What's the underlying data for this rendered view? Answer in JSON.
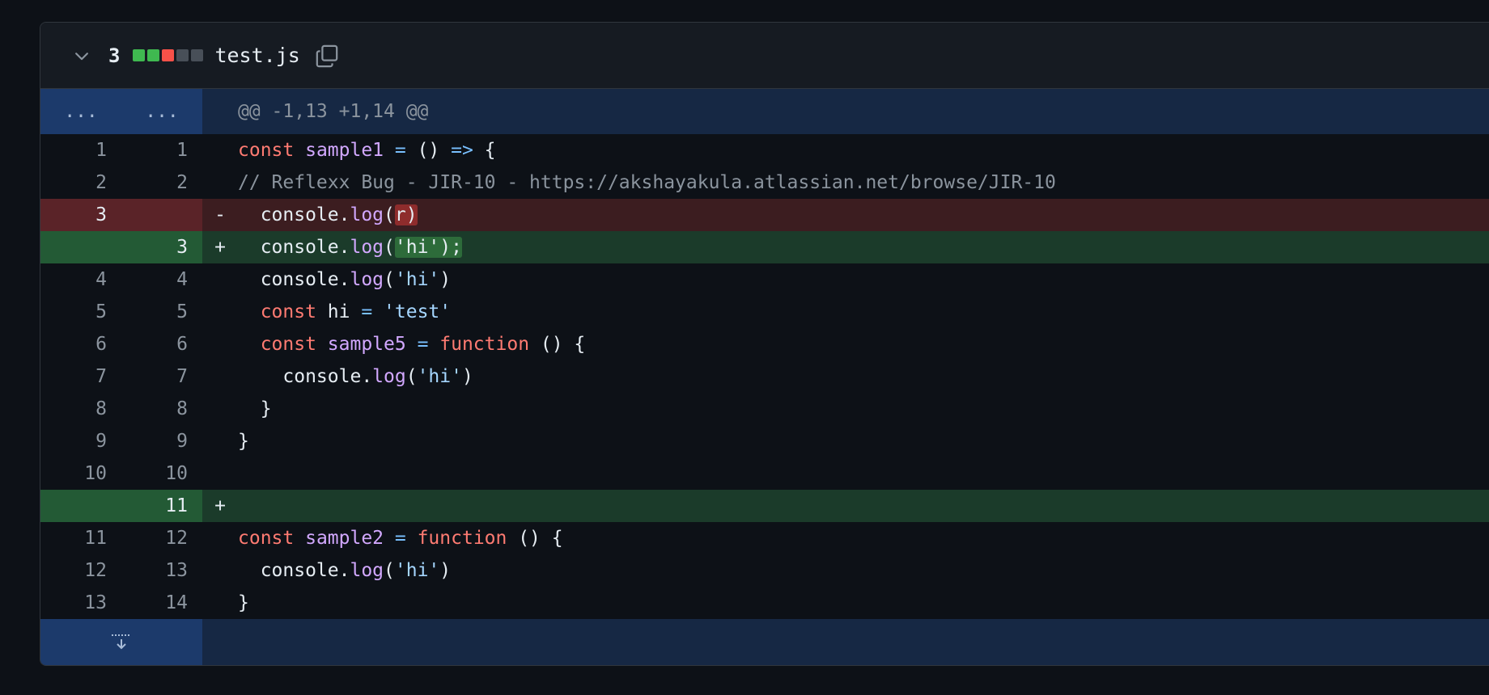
{
  "file": {
    "change_count": "3",
    "name": "test.js",
    "diffstat": [
      "#3fb950",
      "#3fb950",
      "#f85149",
      "#484f58",
      "#484f58"
    ],
    "icons": {
      "collapse": "chevron-down-icon",
      "copy": "copy-icon",
      "expand": "expand-down-icon"
    }
  },
  "hunk": {
    "old_marker": "...",
    "new_marker": "...",
    "header": "@@ -1,13 +1,14 @@"
  },
  "lines": [
    {
      "type": "ctx",
      "old": "1",
      "new": "1",
      "marker": "",
      "tokens": [
        [
          "kw",
          "const "
        ],
        [
          "fn",
          "sample1"
        ],
        [
          "op",
          " = "
        ],
        [
          "pl",
          "() "
        ],
        [
          "op",
          "=>"
        ],
        [
          "pl",
          " {"
        ]
      ]
    },
    {
      "type": "ctx",
      "old": "2",
      "new": "2",
      "marker": "",
      "tokens": [
        [
          "cm",
          "// Reflexx Bug - JIR-10 - https://akshayakula.atlassian.net/browse/JIR-10"
        ]
      ]
    },
    {
      "type": "del",
      "old": "3",
      "new": "",
      "marker": "-",
      "tokens": [
        [
          "pl",
          "  console."
        ],
        [
          "fn",
          "log"
        ],
        [
          "pl",
          "("
        ],
        [
          "hl-del",
          "r)"
        ]
      ]
    },
    {
      "type": "add",
      "old": "",
      "new": "3",
      "marker": "+",
      "tokens": [
        [
          "pl",
          "  console."
        ],
        [
          "fn",
          "log"
        ],
        [
          "pl",
          "("
        ],
        [
          "hl-add",
          "'hi');"
        ]
      ]
    },
    {
      "type": "ctx",
      "old": "4",
      "new": "4",
      "marker": "",
      "tokens": [
        [
          "pl",
          "  console."
        ],
        [
          "fn",
          "log"
        ],
        [
          "pl",
          "("
        ],
        [
          "str",
          "'hi'"
        ],
        [
          "pl",
          ")"
        ]
      ]
    },
    {
      "type": "ctx",
      "old": "5",
      "new": "5",
      "marker": "",
      "tokens": [
        [
          "kw",
          "  const "
        ],
        [
          "pl",
          "hi "
        ],
        [
          "op",
          "= "
        ],
        [
          "str",
          "'test'"
        ]
      ]
    },
    {
      "type": "ctx",
      "old": "6",
      "new": "6",
      "marker": "",
      "tokens": [
        [
          "kw",
          "  const "
        ],
        [
          "fn",
          "sample5"
        ],
        [
          "op",
          " = "
        ],
        [
          "kw",
          "function "
        ],
        [
          "pl",
          "() {"
        ]
      ]
    },
    {
      "type": "ctx",
      "old": "7",
      "new": "7",
      "marker": "",
      "tokens": [
        [
          "pl",
          "    console."
        ],
        [
          "fn",
          "log"
        ],
        [
          "pl",
          "("
        ],
        [
          "str",
          "'hi'"
        ],
        [
          "pl",
          ")"
        ]
      ]
    },
    {
      "type": "ctx",
      "old": "8",
      "new": "8",
      "marker": "",
      "tokens": [
        [
          "pl",
          "  }"
        ]
      ]
    },
    {
      "type": "ctx",
      "old": "9",
      "new": "9",
      "marker": "",
      "tokens": [
        [
          "pl",
          "}"
        ]
      ]
    },
    {
      "type": "ctx",
      "old": "10",
      "new": "10",
      "marker": "",
      "tokens": [
        [
          "pl",
          ""
        ]
      ]
    },
    {
      "type": "add",
      "old": "",
      "new": "11",
      "marker": "+",
      "tokens": [
        [
          "pl",
          ""
        ]
      ]
    },
    {
      "type": "ctx",
      "old": "11",
      "new": "12",
      "marker": "",
      "tokens": [
        [
          "kw",
          "const "
        ],
        [
          "fn",
          "sample2"
        ],
        [
          "op",
          " = "
        ],
        [
          "kw",
          "function "
        ],
        [
          "pl",
          "() {"
        ]
      ]
    },
    {
      "type": "ctx",
      "old": "12",
      "new": "13",
      "marker": "",
      "tokens": [
        [
          "pl",
          "  console."
        ],
        [
          "fn",
          "log"
        ],
        [
          "pl",
          "("
        ],
        [
          "str",
          "'hi'"
        ],
        [
          "pl",
          ")"
        ]
      ]
    },
    {
      "type": "ctx",
      "old": "13",
      "new": "14",
      "marker": "",
      "tokens": [
        [
          "pl",
          "}"
        ]
      ]
    }
  ]
}
